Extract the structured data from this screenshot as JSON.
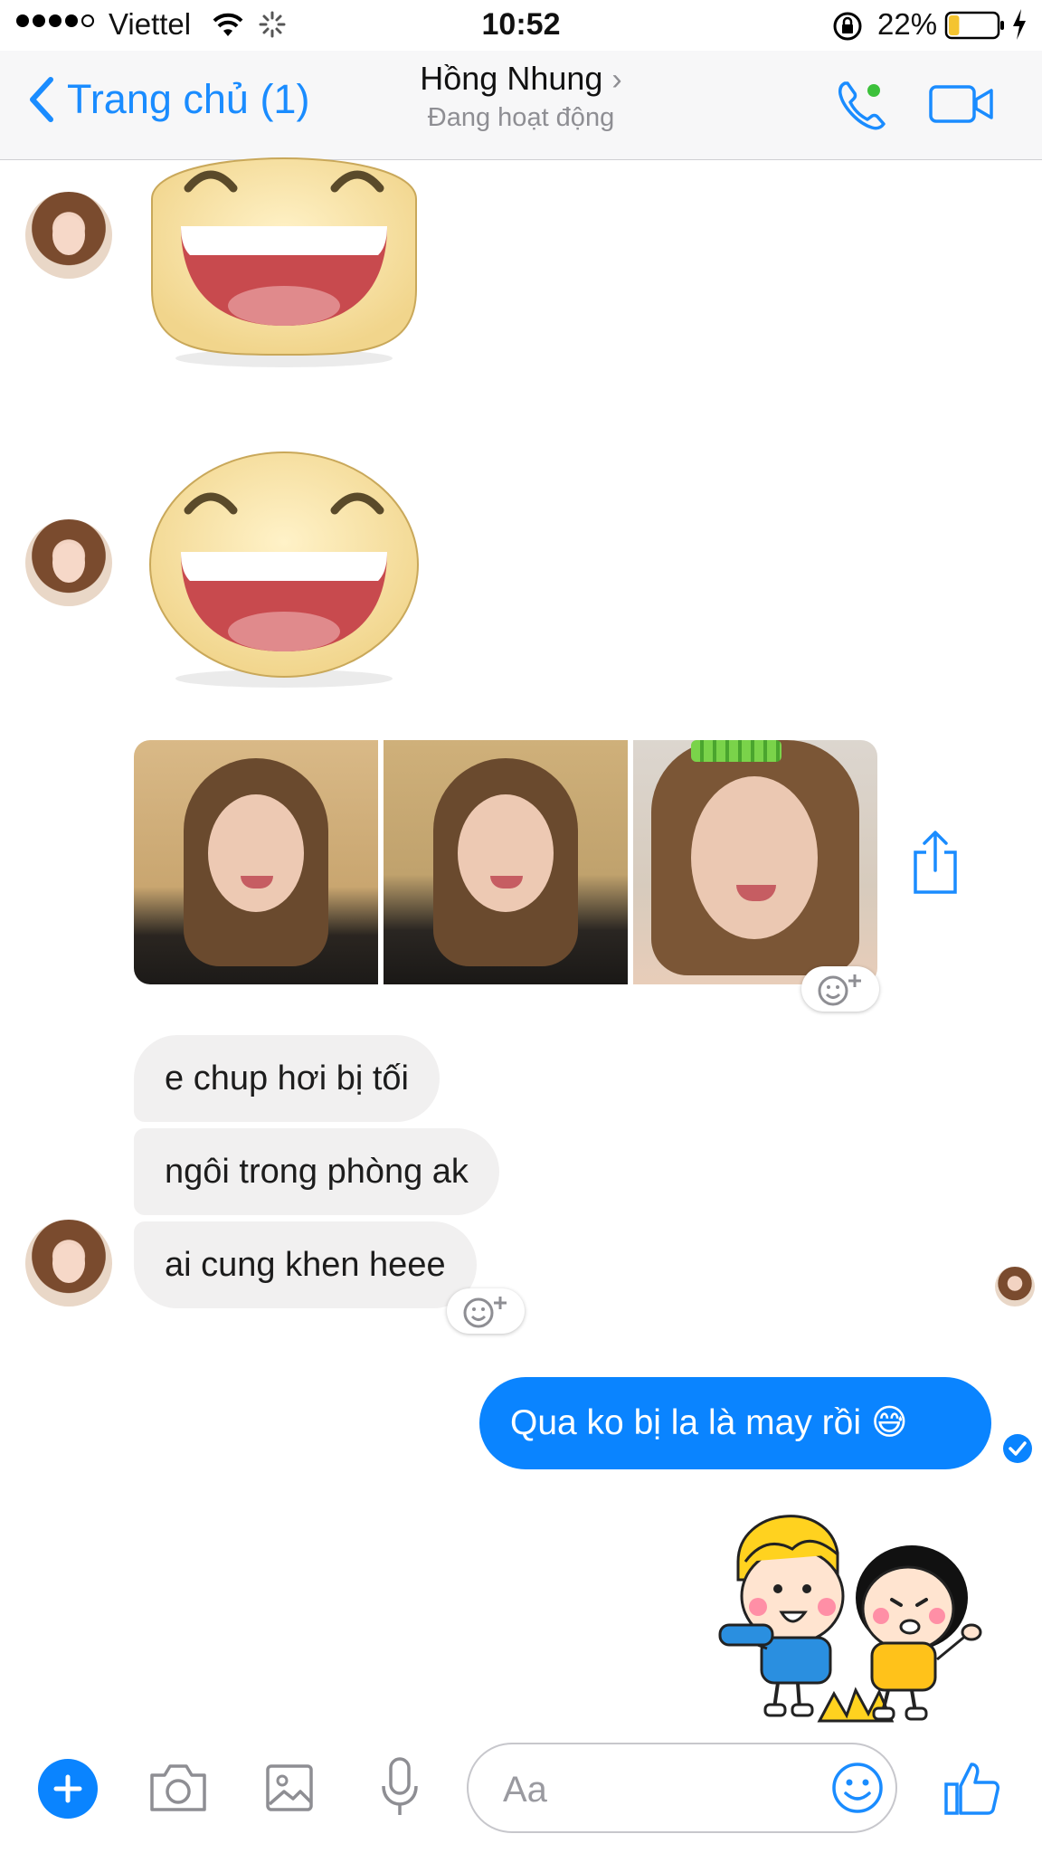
{
  "status_bar": {
    "carrier": "Viettel",
    "time": "10:52",
    "battery_percent": "22%",
    "signal_bars": 4,
    "battery_level": 0.22
  },
  "header": {
    "back_label": "Trang chủ (1)",
    "contact_name": "Hồng Nhung",
    "contact_status": "Đang hoạt động",
    "accent_color": "#1a8cff"
  },
  "messages": {
    "incoming": [
      "e chup hơi bị tối",
      "ngôi trong phòng ak",
      "ai cung khen heee"
    ],
    "outgoing": [
      "Qua ko bị la là may rồi 😅"
    ],
    "photo_count": 3
  },
  "composer": {
    "placeholder": "Aa"
  },
  "colors": {
    "outgoing_bubble": "#0a84ff",
    "incoming_bubble": "#f1f0f0"
  }
}
